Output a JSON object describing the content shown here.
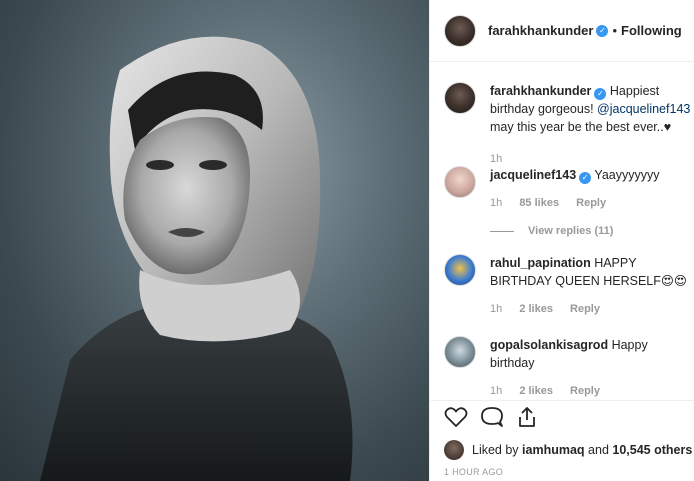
{
  "post": {
    "author": "farahkhankunder",
    "follow_status": "Following",
    "separator": "•",
    "caption_user": "farahkhankunder",
    "caption_text_1": "Happiest birthday gorgeous!",
    "caption_mention": "@jacquelinef143",
    "caption_text_2": "may this year be the best ever..♥",
    "caption_age": "1h"
  },
  "comments": [
    {
      "user": "jacquelinef143",
      "text": "Yaayyyyyyy",
      "age": "1h",
      "likes": "85 likes",
      "reply": "Reply",
      "view_replies": "View replies (11)"
    },
    {
      "user": "rahul_papination",
      "text": "HAPPY BIRTHDAY QUEEN HERSELF😍😍",
      "age": "1h",
      "likes": "2 likes",
      "reply": "Reply"
    },
    {
      "user": "gopalsolankisagrod",
      "text": "Happy birthday",
      "age": "1h",
      "likes": "2 likes",
      "reply": "Reply"
    }
  ],
  "likes": {
    "prefix": "Liked by",
    "user": "iamhumaq",
    "connector": "and",
    "count": "10,545 others"
  },
  "timestamp": "1 HOUR AGO",
  "colors": {
    "verified": "#3897f0",
    "mention": "#003569",
    "muted": "#999999"
  },
  "icons": [
    "verified-badge-icon",
    "heart-icon",
    "comment-icon",
    "share-icon"
  ]
}
